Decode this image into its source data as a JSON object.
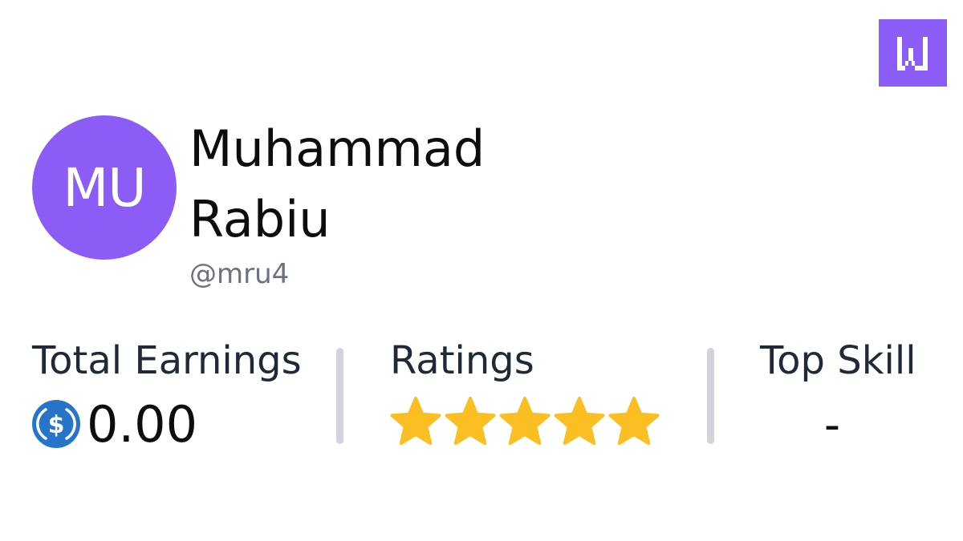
{
  "profile": {
    "initials": "MU",
    "first_name": "Muhammad",
    "last_name": "Rabiu",
    "handle": "@mru4"
  },
  "stats": {
    "earnings_label": "Total Earnings",
    "earnings_value": "0.00",
    "earnings_currency_icon": "usdc-icon",
    "ratings_label": "Ratings",
    "rating_stars": 5,
    "rating_max": 5,
    "top_skill_label": "Top Skill",
    "top_skill_value": "-"
  },
  "branding": {
    "logo_icon": "w-logo-icon"
  },
  "colors": {
    "brand": "#8b5cf6",
    "star": "#fbbf24",
    "usdc": "#2775ca",
    "handle_text": "#6b7280",
    "divider": "#d1d5db"
  }
}
